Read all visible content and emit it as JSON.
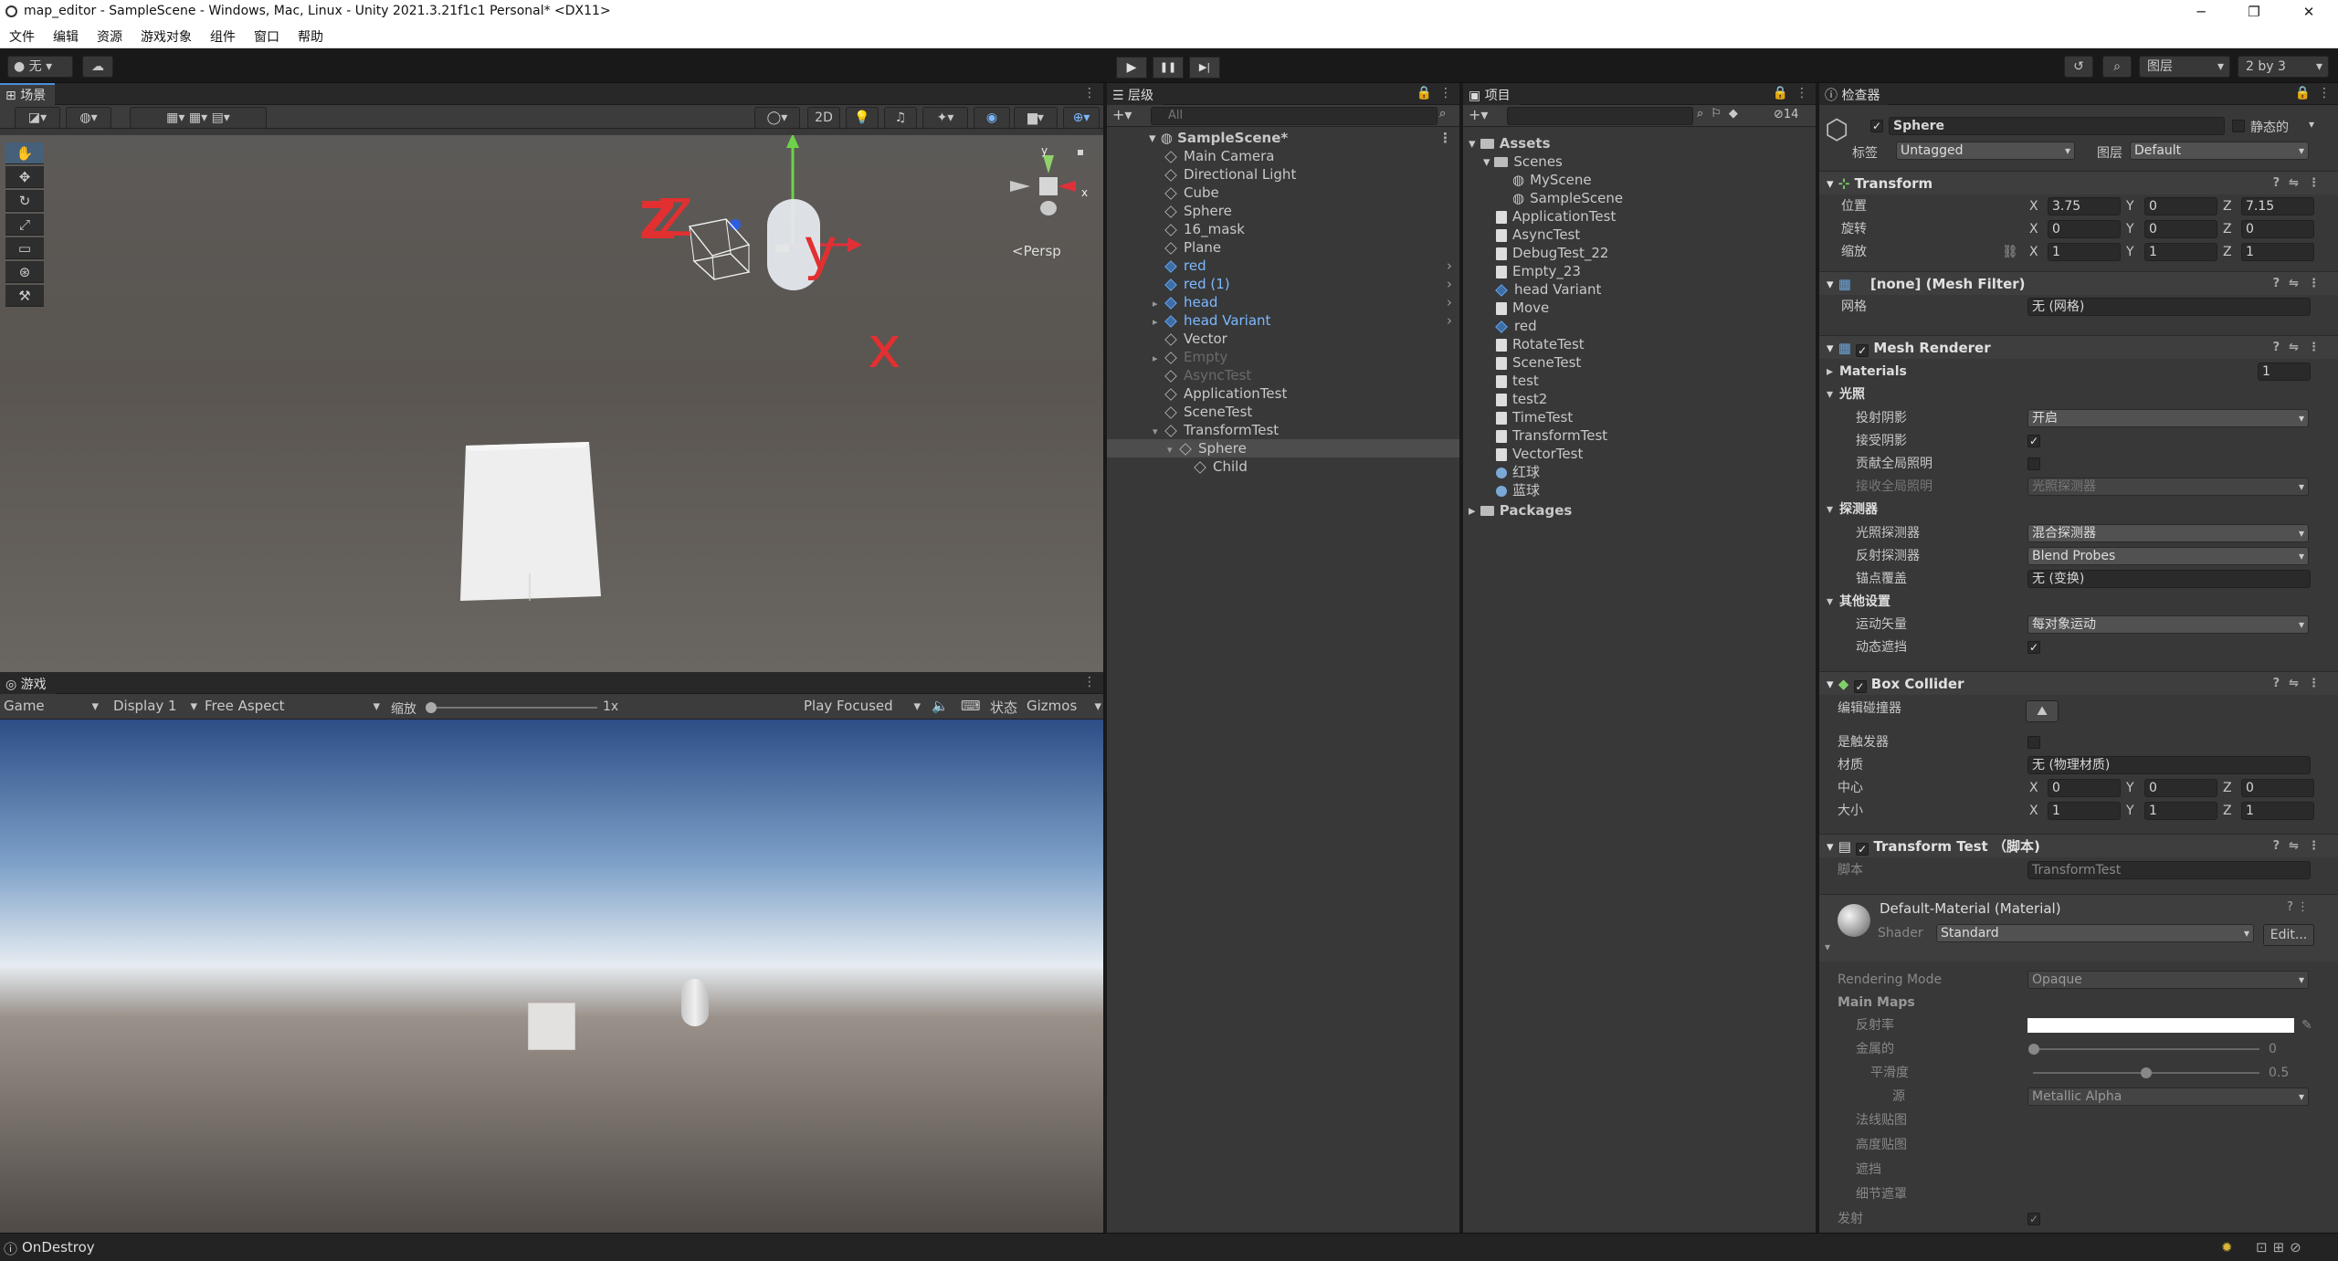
{
  "window": {
    "title": "map_editor - SampleScene - Windows, Mac, Linux - Unity 2021.3.21f1c1 Personal* <DX11>",
    "minimize": "─",
    "maximize": "❐",
    "close": "✕"
  },
  "menu": [
    "文件",
    "编辑",
    "资源",
    "游戏对象",
    "组件",
    "窗口",
    "帮助"
  ],
  "toolbar": {
    "account": "无",
    "layers": "图层",
    "layout": "2 by 3",
    "play": "▶",
    "pause": "❚❚",
    "step": "▶|"
  },
  "scene": {
    "tab": "场景",
    "btn_2d": "2D",
    "persp": "<Persp",
    "axis_y": "y",
    "axis_x": "x",
    "gizmo_y": "y",
    "gizmo_x": "x",
    "gizmo_z": "z"
  },
  "game": {
    "tab": "游戏",
    "mode": "Game",
    "display": "Display 1",
    "aspect": "Free Aspect",
    "scale_label": "缩放",
    "scale_value": "1x",
    "play_mode": "Play Focused",
    "stats": "状态",
    "gizmos": "Gizmos"
  },
  "hierarchy": {
    "tab": "层级",
    "search_placeholder": "All",
    "scene": "SampleScene*",
    "items": [
      {
        "label": "Main Camera",
        "style": "normal",
        "indent": 1
      },
      {
        "label": "Directional Light",
        "style": "normal",
        "indent": 1
      },
      {
        "label": "Cube",
        "style": "normal",
        "indent": 1
      },
      {
        "label": "Sphere",
        "style": "normal",
        "indent": 1
      },
      {
        "label": "16_mask",
        "style": "normal",
        "indent": 1
      },
      {
        "label": "Plane",
        "style": "normal",
        "indent": 1
      },
      {
        "label": "red",
        "style": "blue",
        "indent": 1
      },
      {
        "label": "red (1)",
        "style": "blue",
        "indent": 1
      },
      {
        "label": "head",
        "style": "blue",
        "indent": 1
      },
      {
        "label": "head Variant",
        "style": "blue",
        "indent": 1
      },
      {
        "label": "Vector",
        "style": "normal",
        "indent": 1
      },
      {
        "label": "Empty",
        "style": "dim",
        "indent": 1
      },
      {
        "label": "AsyncTest",
        "style": "dim",
        "indent": 1
      },
      {
        "label": "ApplicationTest",
        "style": "normal",
        "indent": 1
      },
      {
        "label": "SceneTest",
        "style": "normal",
        "indent": 1
      },
      {
        "label": "TransformTest",
        "style": "normal",
        "indent": 1
      },
      {
        "label": "Sphere",
        "style": "selected",
        "indent": 2
      },
      {
        "label": "Child",
        "style": "normal",
        "indent": 3
      }
    ]
  },
  "project": {
    "tab": "项目",
    "hidden_count": "14",
    "root": "Assets",
    "scenes_folder": "Scenes",
    "scenes": [
      "MyScene",
      "SampleScene"
    ],
    "assets": [
      "ApplicationTest",
      "AsyncTest",
      "DebugTest_22",
      "Empty_23",
      "head Variant",
      "Move",
      "red",
      "RotateTest",
      "SceneTest",
      "test",
      "test2",
      "TimeTest",
      "TransformTest",
      "VectorTest",
      "红球",
      "蓝球"
    ],
    "packages": "Packages"
  },
  "inspector": {
    "tab": "检查器",
    "object_name": "Sphere",
    "static_label": "静态的",
    "tag_label": "标签",
    "tag_value": "Untagged",
    "layer_label": "图层",
    "layer_value": "Default",
    "transform": {
      "title": "Transform",
      "position_label": "位置",
      "rotation_label": "旋转",
      "scale_label": "缩放",
      "position": [
        "3.75",
        "0",
        "7.15"
      ],
      "rotation": [
        "0",
        "0",
        "0"
      ],
      "scale": [
        "1",
        "1",
        "1"
      ]
    },
    "mesh_filter": {
      "title": "[none] (Mesh Filter)",
      "mesh_label": "网格",
      "mesh_value": "无 (网格)"
    },
    "mesh_renderer": {
      "title": "Mesh Renderer",
      "materials_label": "Materials",
      "materials_count": "1",
      "lighting_label": "光照",
      "cast_shadows_label": "投射阴影",
      "cast_shadows_value": "开启",
      "receive_shadows_label": "接受阴影",
      "contribute_gi_label": "贡献全局照明",
      "receive_gi_label": "接收全局照明",
      "receive_gi_value": "光照探测器",
      "probes_label": "探测器",
      "light_probes_label": "光照探测器",
      "light_probes_value": "混合探测器",
      "reflection_probes_label": "反射探测器",
      "reflection_probes_value": "Blend Probes",
      "anchor_label": "锚点覆盖",
      "anchor_value": "无 (变换)",
      "other_label": "其他设置",
      "motion_vectors_label": "运动矢量",
      "motion_vectors_value": "每对象运动",
      "dynamic_occlusion_label": "动态遮挡"
    },
    "box_collider": {
      "title": "Box Collider",
      "edit_label": "编辑碰撞器",
      "trigger_label": "是触发器",
      "material_label": "材质",
      "material_value": "无 (物理材质)",
      "center_label": "中心",
      "size_label": "大小",
      "center": [
        "0",
        "0",
        "0"
      ],
      "size": [
        "1",
        "1",
        "1"
      ]
    },
    "script": {
      "title": "Transform Test （脚本)",
      "script_label": "脚本",
      "script_value": "TransformTest"
    },
    "material": {
      "title": "Default-Material (Material)",
      "shader_label": "Shader",
      "shader_value": "Standard",
      "edit_label": "Edit...",
      "rendering_mode_label": "Rendering Mode",
      "rendering_mode_value": "Opaque",
      "main_maps_label": "Main Maps",
      "albedo_label": "反射率",
      "metallic_label": "金属的",
      "metallic_value": "0",
      "smoothness_label": "平滑度",
      "smoothness_value": "0.5",
      "source_label": "源",
      "source_value": "Metallic Alpha",
      "normal_label": "法线贴图",
      "height_label": "高度贴图",
      "occlusion_label": "遮挡",
      "detail_mask_label": "细节遮罩",
      "emission_label": "发射"
    }
  },
  "status": {
    "message": "OnDestroy"
  }
}
